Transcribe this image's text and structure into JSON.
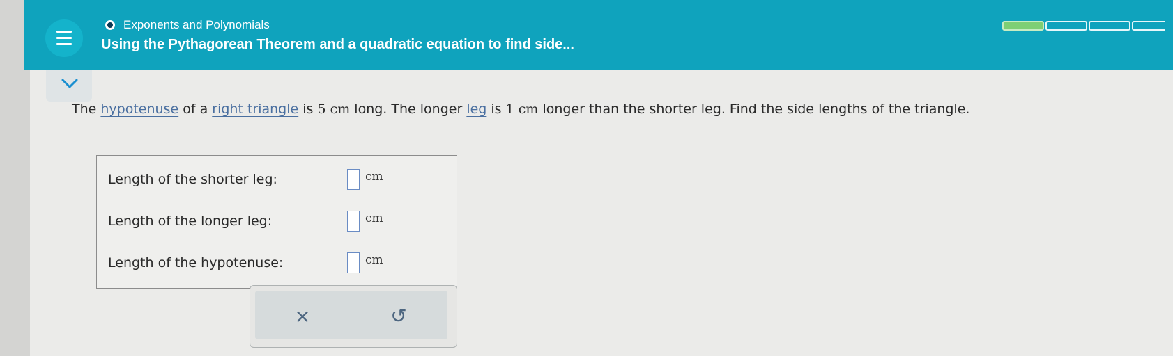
{
  "header": {
    "topic": "Exponents and Polynomials",
    "title": "Using the Pythagorean Theorem and a quadratic equation to find side...",
    "progress": {
      "filled_segments": 1,
      "total_segments": 4
    }
  },
  "question": {
    "text_1": "The ",
    "link_hypotenuse": "hypotenuse",
    "text_2": " of a ",
    "link_right_triangle": "right triangle",
    "text_3": " is ",
    "value_hyp": "5 cm",
    "text_4": " long. The longer ",
    "link_leg": "leg",
    "text_5": " is ",
    "value_diff": "1 cm",
    "text_6": " longer than the shorter leg. Find the side lengths of the triangle."
  },
  "answers": {
    "shorter_label": "Length of the shorter leg:",
    "longer_label": "Length of the longer leg:",
    "hyp_label": "Length of the hypotenuse:",
    "unit": "cm",
    "shorter_value": "",
    "longer_value": "",
    "hyp_value": ""
  },
  "controls": {
    "clear_symbol": "×",
    "undo_symbol": "↺"
  },
  "icons": [
    "menu-icon",
    "chevron-down-icon",
    "topic-dot-icon"
  ],
  "colors": {
    "header_bg": "#0fa3bd",
    "progress_fill": "#7ecf74",
    "link": "#4a6fa0",
    "input_border": "#6a8cc4"
  }
}
